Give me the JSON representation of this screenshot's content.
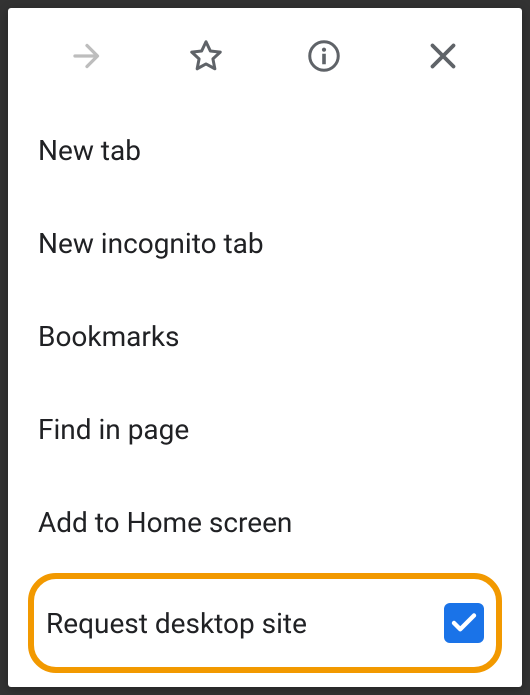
{
  "iconRow": {
    "forward": "forward",
    "star": "star",
    "info": "info",
    "close": "close"
  },
  "menu": {
    "newTab": "New tab",
    "newIncognito": "New incognito tab",
    "bookmarks": "Bookmarks",
    "findInPage": "Find in page",
    "addToHome": "Add to Home screen",
    "requestDesktop": "Request desktop site"
  },
  "requestDesktopChecked": true
}
